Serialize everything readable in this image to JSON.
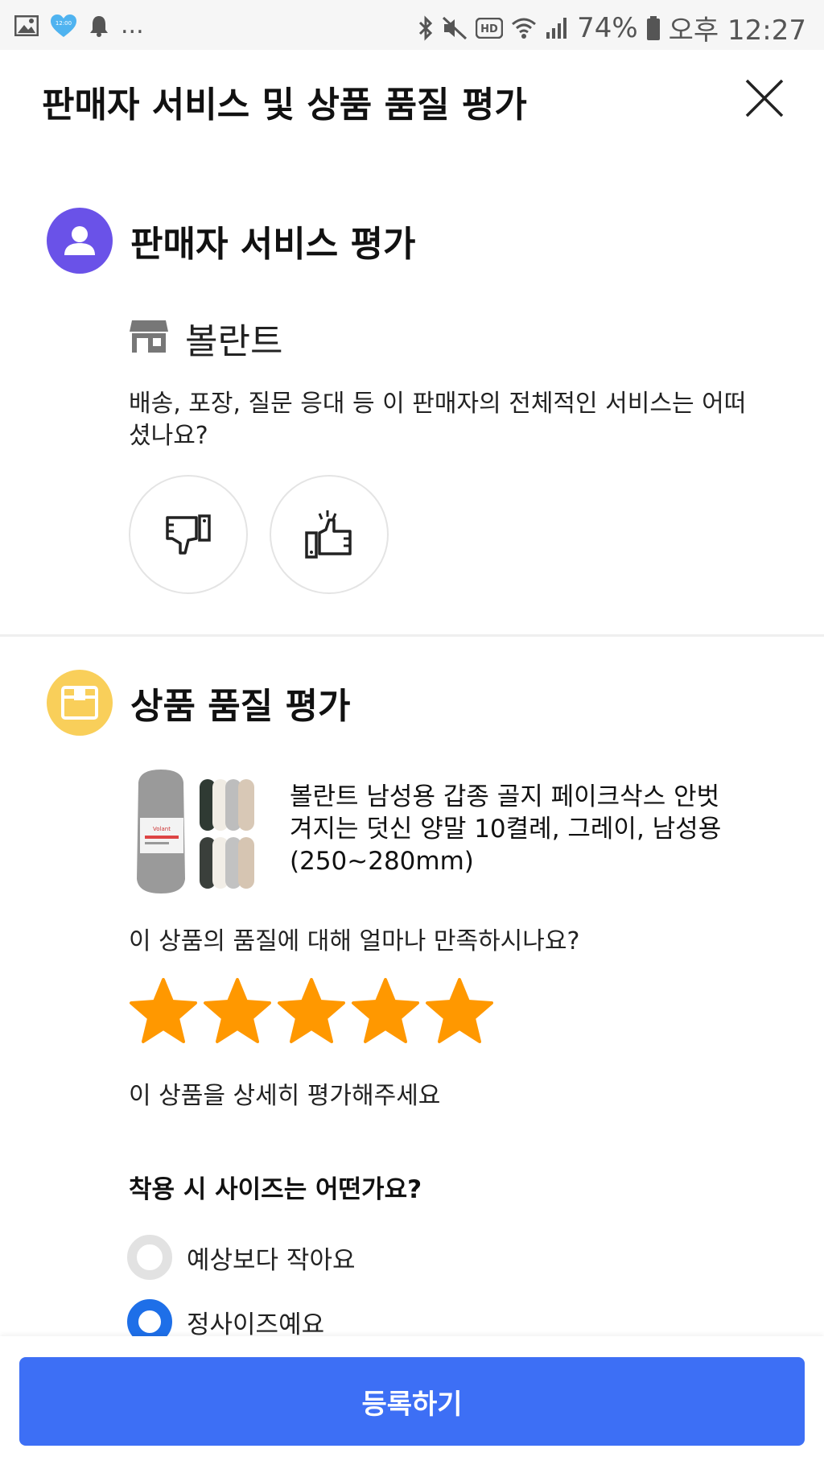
{
  "status_bar": {
    "battery": "74%",
    "time": "오후 12:27",
    "heart_badge": "12:00",
    "more": "..."
  },
  "header": {
    "title": "판매자 서비스 및 상품 품질 평가"
  },
  "seller_section": {
    "title": "판매자 서비스 평가",
    "store_name": "볼란트",
    "question": "배송, 포장, 질문 응대 등 이 판매자의 전체적인 서비스는 어떠셨나요?",
    "icon_color": "#6a52e8"
  },
  "quality_section": {
    "title": "상품 품질 평가",
    "icon_color": "#f9cf5a",
    "product_name": "볼란트 남성용 갑종 골지 페이크삭스 안벗겨지는 덧신 양말 10켤례, 그레이, 남성용(250~280mm)",
    "satisfaction_question": "이 상품의 품질에 대해 얼마나 만족하시나요?",
    "rating": 5,
    "rating_max": 5,
    "star_color": "#ff9800",
    "detail_prompt": "이 상품을 상세히 평가해주세요",
    "size_question": "착용 시 사이즈는 어떤가요?",
    "size_options": [
      {
        "label": "예상보다 작아요",
        "selected": false
      },
      {
        "label": "정사이즈예요",
        "selected": true
      }
    ]
  },
  "submit": {
    "label": "등록하기",
    "color": "#3d6ff5"
  }
}
